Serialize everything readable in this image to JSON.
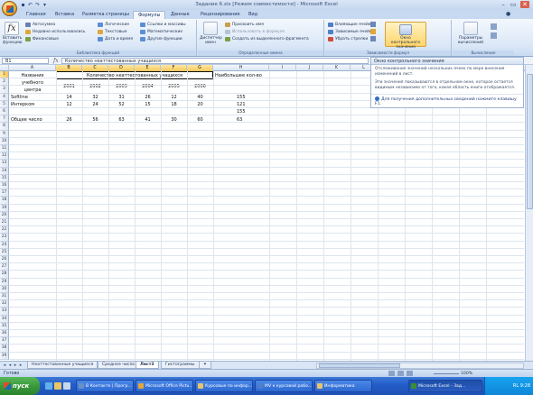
{
  "window": {
    "title": "Задание 6.xls [Режим совместимости] - Microsoft Excel",
    "controls": [
      "–",
      "▭",
      "✕"
    ]
  },
  "ribbon_tabs": [
    "Главная",
    "Вставка",
    "Разметка страницы",
    "Формулы",
    "Данные",
    "Рецензирование",
    "Вид"
  ],
  "ribbon": {
    "insert_function": "Вставить функцию",
    "library_items": [
      "Автосумма",
      "Недавно использовались",
      "Финансовые",
      "Логические",
      "Текстовые",
      "Дата и время",
      "Ссылки и массивы",
      "Математические",
      "Другие функции"
    ],
    "library_title": "Библиотека функций",
    "names_manager": "Диспетчер имен",
    "names_items": [
      "Присвоить имя",
      "Использовать в формуле",
      "Создать из выделенного фрагмента"
    ],
    "names_title": "Определенные имена",
    "audit_items": [
      "Влияющие ячейки",
      "Зависимые ячейки",
      "Убрать стрелки"
    ],
    "watch_window": "Окно контрольного значения",
    "audit_title": "Зависимости формул",
    "calc_options": "Параметры вычислений",
    "calc_title": "Вычисление"
  },
  "formula_bar": {
    "name_box": "B1",
    "fx": "fx",
    "formula": "Количество неаттестованных учащихся"
  },
  "columns": [
    "A",
    "B",
    "C",
    "D",
    "E",
    "F",
    "G",
    "H",
    "I",
    "J",
    "K",
    "L"
  ],
  "rows": [
    "1",
    "2",
    "3",
    "4",
    "5",
    "6",
    "7",
    "8",
    "9",
    "10",
    "11",
    "12",
    "13",
    "14",
    "15",
    "16",
    "17",
    "18",
    "19",
    "20",
    "21",
    "22",
    "23",
    "24",
    "25",
    "26",
    "27",
    "28",
    "29",
    "30",
    "31",
    "32",
    "33",
    "34",
    "35",
    "36",
    "37",
    "38",
    "39"
  ],
  "cells": {
    "a1": "Название",
    "a2": "учебного",
    "a3": "центра",
    "b1": "Количество неаттестованных учащихся",
    "h1": "Наибольшее кол-во",
    "years": [
      "2001",
      "2002",
      "2003",
      "2004",
      "2005",
      "2006"
    ],
    "a4": "Softline",
    "row4": [
      "14",
      "32",
      "31",
      "26",
      "12",
      "40"
    ],
    "h4": "155",
    "a5": "Интерком",
    "row5": [
      "12",
      "24",
      "52",
      "15",
      "18",
      "20"
    ],
    "h5": "121",
    "h6": "155",
    "a7": "Общее число",
    "row7": [
      "26",
      "56",
      "63",
      "41",
      "30",
      "60"
    ],
    "h7": "63"
  },
  "task_pane": {
    "title": "Окно контрольного значения",
    "text1": "Отслеживание значений нескольких ячеек по мере внесения изменений в лист.",
    "text2": "Эти значения показываются в отдельном окне, которое остается видимым независимо от того, какая область книги отображается.",
    "link": "Для получения дополнительных сведений нажмите клавишу F1."
  },
  "sheet_tabs": [
    "Неаттестованные учащиеся",
    "Среднее число",
    "Лист3",
    "Гистограммы"
  ],
  "active_sheet": "Лист3",
  "status": {
    "text": "Готово",
    "zoom": "100%"
  },
  "taskbar": {
    "start": "пуск",
    "items": [
      "В Контакте | Прогр...",
      "Microsoft Office Pictu...",
      "Курсовые по инфор...",
      "MV к курсовой рабо...",
      "Информатика",
      "Microsoft Excel - Зад..."
    ],
    "tray": "RL 9:28"
  }
}
